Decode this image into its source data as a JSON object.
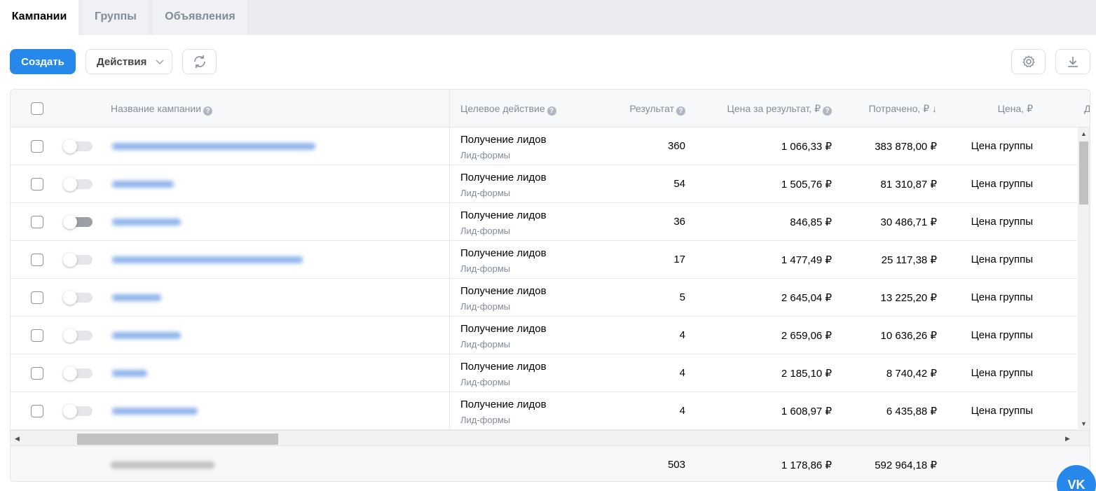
{
  "tabs": [
    {
      "label": "Кампании",
      "active": true
    },
    {
      "label": "Группы",
      "active": false
    },
    {
      "label": "Объявления",
      "active": false
    }
  ],
  "toolbar": {
    "create_label": "Создать",
    "actions_label": "Действия",
    "refresh_icon": "refresh-icon",
    "settings_icon": "gear-icon",
    "download_icon": "download-icon"
  },
  "table": {
    "columns": {
      "name": "Название кампании",
      "target": "Целевое действие",
      "result": "Результат",
      "cost_per_result": "Цена за результат, ₽",
      "spent": "Потрачено, ₽ ↓",
      "price": "Цена, ₽",
      "next": "Д"
    },
    "rows": [
      {
        "target": "Получение лидов",
        "target_sub": "Лид-формы",
        "result": "360",
        "cost_per_result": "1 066,33 ₽",
        "spent": "383 878,00 ₽",
        "price": "Цена группы",
        "enabled": false
      },
      {
        "target": "Получение лидов",
        "target_sub": "Лид-формы",
        "result": "54",
        "cost_per_result": "1 505,76 ₽",
        "spent": "81 310,87 ₽",
        "price": "Цена группы",
        "enabled": false
      },
      {
        "target": "Получение лидов",
        "target_sub": "Лид-формы",
        "result": "36",
        "cost_per_result": "846,85 ₽",
        "spent": "30 486,71 ₽",
        "price": "Цена группы",
        "enabled": true
      },
      {
        "target": "Получение лидов",
        "target_sub": "Лид-формы",
        "result": "17",
        "cost_per_result": "1 477,49 ₽",
        "spent": "25 117,38 ₽",
        "price": "Цена группы",
        "enabled": false
      },
      {
        "target": "Получение лидов",
        "target_sub": "Лид-формы",
        "result": "5",
        "cost_per_result": "2 645,04 ₽",
        "spent": "13 225,20 ₽",
        "price": "Цена группы",
        "enabled": false
      },
      {
        "target": "Получение лидов",
        "target_sub": "Лид-формы",
        "result": "4",
        "cost_per_result": "2 659,06 ₽",
        "spent": "10 636,26 ₽",
        "price": "Цена группы",
        "enabled": false
      },
      {
        "target": "Получение лидов",
        "target_sub": "Лид-формы",
        "result": "4",
        "cost_per_result": "2 185,10 ₽",
        "spent": "8 740,42 ₽",
        "price": "Цена группы",
        "enabled": false
      },
      {
        "target": "Получение лидов",
        "target_sub": "Лид-формы",
        "result": "4",
        "cost_per_result": "1 608,97 ₽",
        "spent": "6 435,88 ₽",
        "price": "Цена группы",
        "enabled": false
      }
    ],
    "totals": {
      "result": "503",
      "cost_per_result": "1 178,86 ₽",
      "spent": "592 964,18 ₽"
    }
  },
  "fab": {
    "label": "VK"
  },
  "colors": {
    "accent": "#2688eb",
    "muted": "#818c99",
    "border": "#e3e5e8"
  }
}
